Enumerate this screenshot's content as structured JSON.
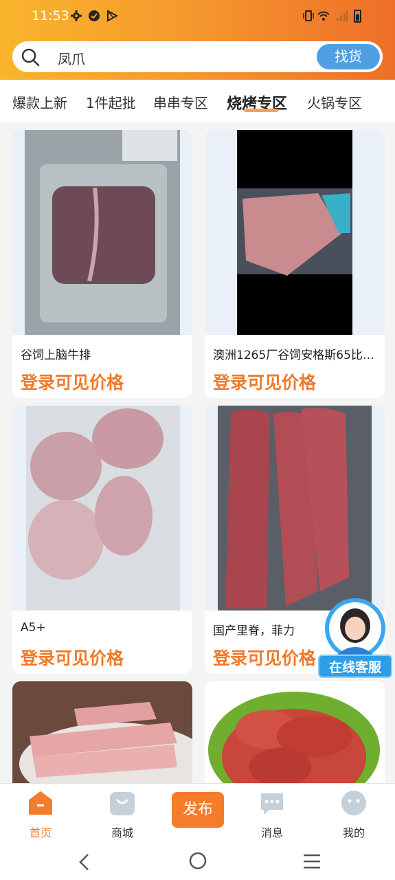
{
  "status_bar": {
    "time": "11:53"
  },
  "search": {
    "value": "凤爪",
    "button_label": "找货"
  },
  "category_tabs": [
    {
      "label": "爆款上新"
    },
    {
      "label": "1件起批"
    },
    {
      "label": "串串专区"
    },
    {
      "label": "烧烤专区",
      "active": true
    },
    {
      "label": "火锅专区"
    }
  ],
  "products": [
    {
      "title": "谷饲上脑牛排",
      "price": "登录可见价格",
      "image": "vacuum-packed-steak"
    },
    {
      "title": "澳洲1265厂谷饲安格斯65比…",
      "price": "登录可见价格",
      "image": "frozen-beef-block"
    },
    {
      "title": "A5+",
      "price": "登录可见价格",
      "image": "wagyu-steaks"
    },
    {
      "title": "国产里脊，菲力",
      "price": "登录可见价格",
      "image": "beef-tenderloin"
    },
    {
      "title": "",
      "price": "",
      "image": "pork-ribs"
    },
    {
      "title": "",
      "price": "",
      "image": "sausages"
    }
  ],
  "customer_service": {
    "label": "在线客服"
  },
  "bottom_nav": [
    {
      "label": "首页",
      "icon": "home-icon",
      "active": true
    },
    {
      "label": "商城",
      "icon": "shop-bag-icon"
    },
    {
      "label": "发布",
      "icon": "publish-button"
    },
    {
      "label": "消息",
      "icon": "message-icon"
    },
    {
      "label": "我的",
      "icon": "profile-icon"
    }
  ],
  "colors": {
    "accent": "#f07a2a",
    "header_start": "#f9b52b",
    "header_end": "#ee6f28",
    "search_button": "#4ea0e3"
  }
}
